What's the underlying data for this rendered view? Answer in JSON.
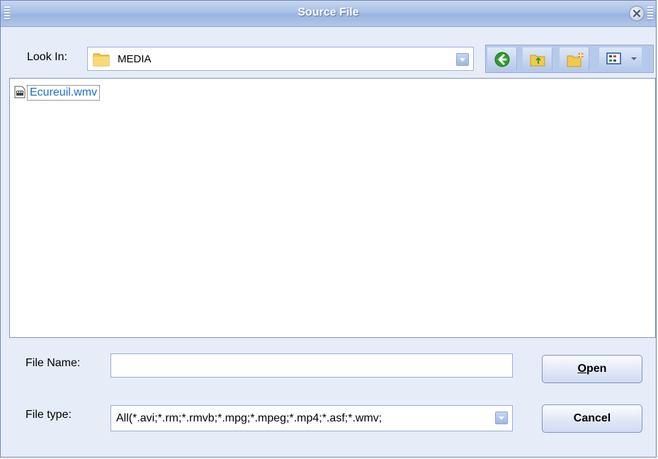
{
  "window": {
    "title": "Source File",
    "close_icon": "close-icon"
  },
  "lookin": {
    "label": "Look In:",
    "value": "MEDIA",
    "icon": "folder-icon"
  },
  "toolbar": {
    "buttons": [
      {
        "name": "back-button",
        "icon": "back-arrow-icon"
      },
      {
        "name": "up-folder-button",
        "icon": "up-folder-icon"
      },
      {
        "name": "new-folder-button",
        "icon": "new-folder-icon"
      },
      {
        "name": "view-menu-button",
        "icon": "view-list-icon"
      }
    ]
  },
  "files": [
    {
      "name": "Ecureuil.wmv",
      "icon": "video-file-icon"
    }
  ],
  "filename": {
    "label": "File Name:",
    "value": "",
    "placeholder": ""
  },
  "filetype": {
    "label": "File type:",
    "value": "All(*.avi;*.rm;*.rmvb;*.mpg;*.mpeg;*.mp4;*.asf;*.wmv;"
  },
  "buttons": {
    "open_first": "O",
    "open_rest": "pen",
    "cancel": "Cancel"
  },
  "colors": {
    "title_bar": "#a9bfe6",
    "window_bg": "#e6ecf8",
    "file_link": "#1a6fd0",
    "back_button_green": "#2e9e2b"
  }
}
